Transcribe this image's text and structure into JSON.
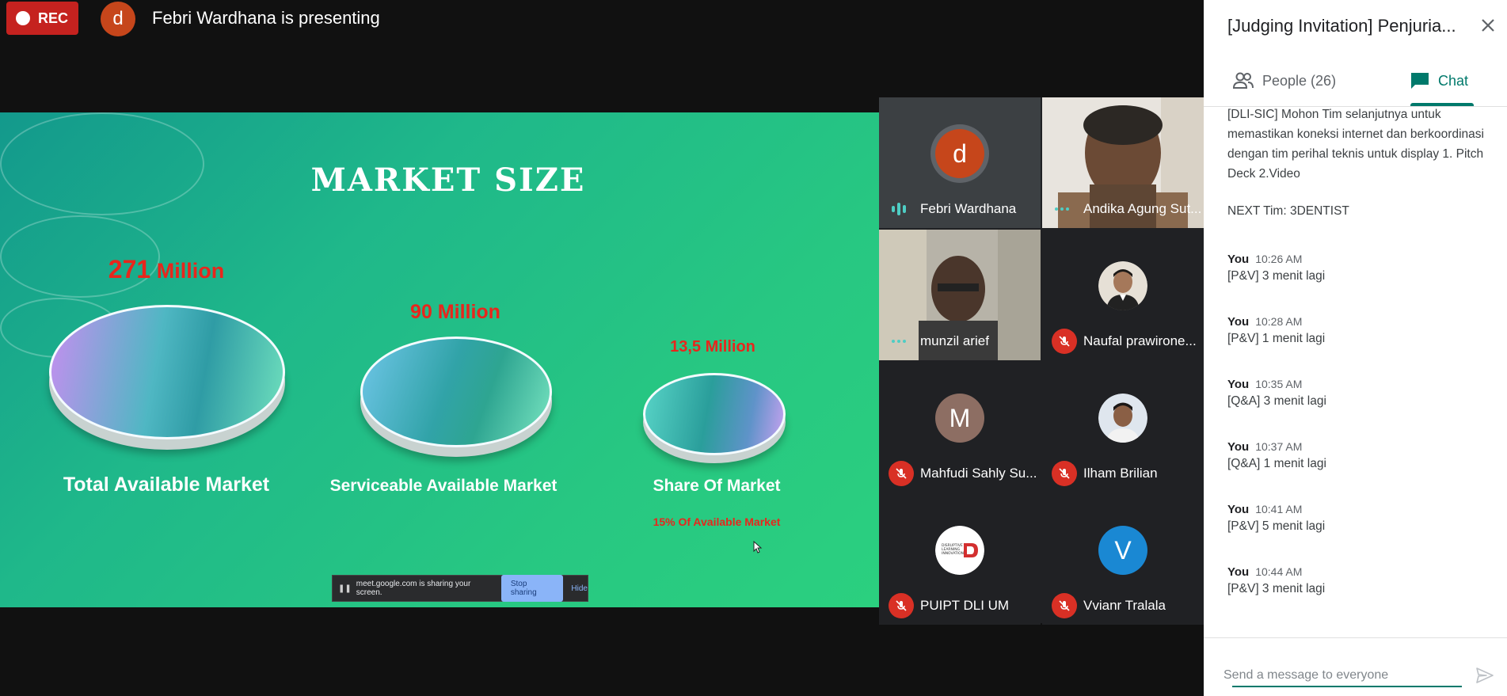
{
  "topbar": {
    "rec_label": "REC",
    "presenter_initial": "d",
    "presenter_text": "Febri Wardhana is presenting"
  },
  "slide": {
    "title": "MARKET SIZE",
    "markets": [
      {
        "value_num": "271",
        "value_unit": "Million",
        "label": "Total Available Market"
      },
      {
        "value": "90 Million",
        "label": "Serviceable Available Market"
      },
      {
        "value": "13,5 Million",
        "label": "Share Of Market",
        "note": "15% Of Available Market"
      }
    ]
  },
  "sharebar": {
    "text": "meet.google.com is sharing your screen.",
    "stop_label": "Stop sharing",
    "hide_label": "Hide"
  },
  "participants": [
    {
      "name": "Febri Wardhana",
      "initial": "d",
      "avatar_color": "#c6461b",
      "status": "speaking"
    },
    {
      "name": "Andika Agung Sut...",
      "status": "active-video"
    },
    {
      "name": "munzil arief",
      "status": "active-video"
    },
    {
      "name": "Naufal prawirone...",
      "status": "muted"
    },
    {
      "name": "Mahfudi Sahly Su...",
      "initial": "M",
      "avatar_color": "#8d6e63",
      "status": "muted"
    },
    {
      "name": "Ilham Brilian",
      "status": "muted"
    },
    {
      "name": "PUIPT DLI UM",
      "status": "muted"
    },
    {
      "name": "Vvianr Tralala",
      "initial": "V",
      "avatar_color": "#1a88d3",
      "status": "muted"
    }
  ],
  "panel": {
    "title": "[Judging Invitation] Penjuria...",
    "people_tab": "People (26)",
    "chat_tab": "Chat",
    "system_message": "[DLI-SIC] Mohon Tim selanjutnya untuk memastikan koneksi internet dan berkoordinasi dengan tim perihal teknis untuk display 1. Pitch Deck 2.Video",
    "next_team": "NEXT Tim: 3DENTIST",
    "messages": [
      {
        "sender": "You",
        "time": "10:26 AM",
        "text": "[P&V] 3 menit lagi"
      },
      {
        "sender": "You",
        "time": "10:28 AM",
        "text": "[P&V] 1 menit lagi"
      },
      {
        "sender": "You",
        "time": "10:35 AM",
        "text": "[Q&A] 3 menit lagi"
      },
      {
        "sender": "You",
        "time": "10:37 AM",
        "text": "[Q&A] 1 menit lagi"
      },
      {
        "sender": "You",
        "time": "10:41 AM",
        "text": "[P&V] 5 menit lagi"
      },
      {
        "sender": "You",
        "time": "10:44 AM",
        "text": "[P&V] 3 menit lagi"
      }
    ],
    "input_placeholder": "Send a message to everyone"
  },
  "colors": {
    "accent": "#00796b",
    "rec": "#c5221f",
    "muted_mic": "#d93025",
    "slide_value": "#e8261c"
  }
}
